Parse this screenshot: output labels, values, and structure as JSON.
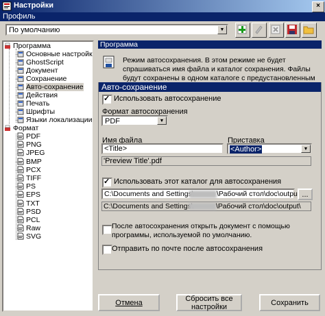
{
  "window": {
    "title": "Настройки",
    "close": "×"
  },
  "menu": {
    "profile": "Профиль"
  },
  "profile_combo": {
    "value": "По умолчанию"
  },
  "toolbar": {
    "icons": [
      "add-icon",
      "edit-icon",
      "delete-icon",
      "save-icon",
      "open-folder-icon"
    ]
  },
  "tree": {
    "programma": "Программа",
    "programma_children": [
      "Основные настройки",
      "GhostScript",
      "Документ",
      "Сохранение",
      "Авто-сохранение",
      "Действия",
      "Печать",
      "Шрифты",
      "Языки локализации"
    ],
    "format": "Формат",
    "format_children": [
      "PDF",
      "PNG",
      "JPEG",
      "BMP",
      "PCX",
      "TIFF",
      "PS",
      "EPS",
      "TXT",
      "PSD",
      "PCL",
      "Raw",
      "SVG"
    ]
  },
  "section": {
    "header": "Программа",
    "description": "Режим автосохранения. В этом режиме не будет спрашиваться имя файла и каталог сохранения. Файлы будут сохранены в одном каталоге с предустановленным именем файла."
  },
  "autosave": {
    "header": "Авто-сохранение",
    "use_label": "Использовать автосохранение",
    "use_checked": true,
    "format_label": "Формат автосохранения",
    "format_value": "PDF",
    "filename_label": "Имя файла",
    "filename_value": "<Title>",
    "prefix_label": "Приставка",
    "prefix_value": "<Author>",
    "preview": "'Preview Title'.pdf",
    "dir_label": "Использовать этот каталог для автосохранения",
    "dir_checked": true,
    "dir_value": "C:\\Documents and Settings\\",
    "dir_value_tail": "\\Рабочий стол\\doc\\output\\",
    "dir_preview": "C:\\Documents and Settings\\",
    "dir_preview_tail": "\\Рабочий стол\\doc\\output\\",
    "browse": "...",
    "open_after_label": "После автосохранения открыть документ с помощью программы, используемой по умолчанию.",
    "open_after_checked": false,
    "send_mail_label": "Отправить по почте после автосохранения",
    "send_mail_checked": false
  },
  "buttons": {
    "cancel": "Отмена",
    "reset": "Сбросить все настройки",
    "save": "Сохранить"
  }
}
